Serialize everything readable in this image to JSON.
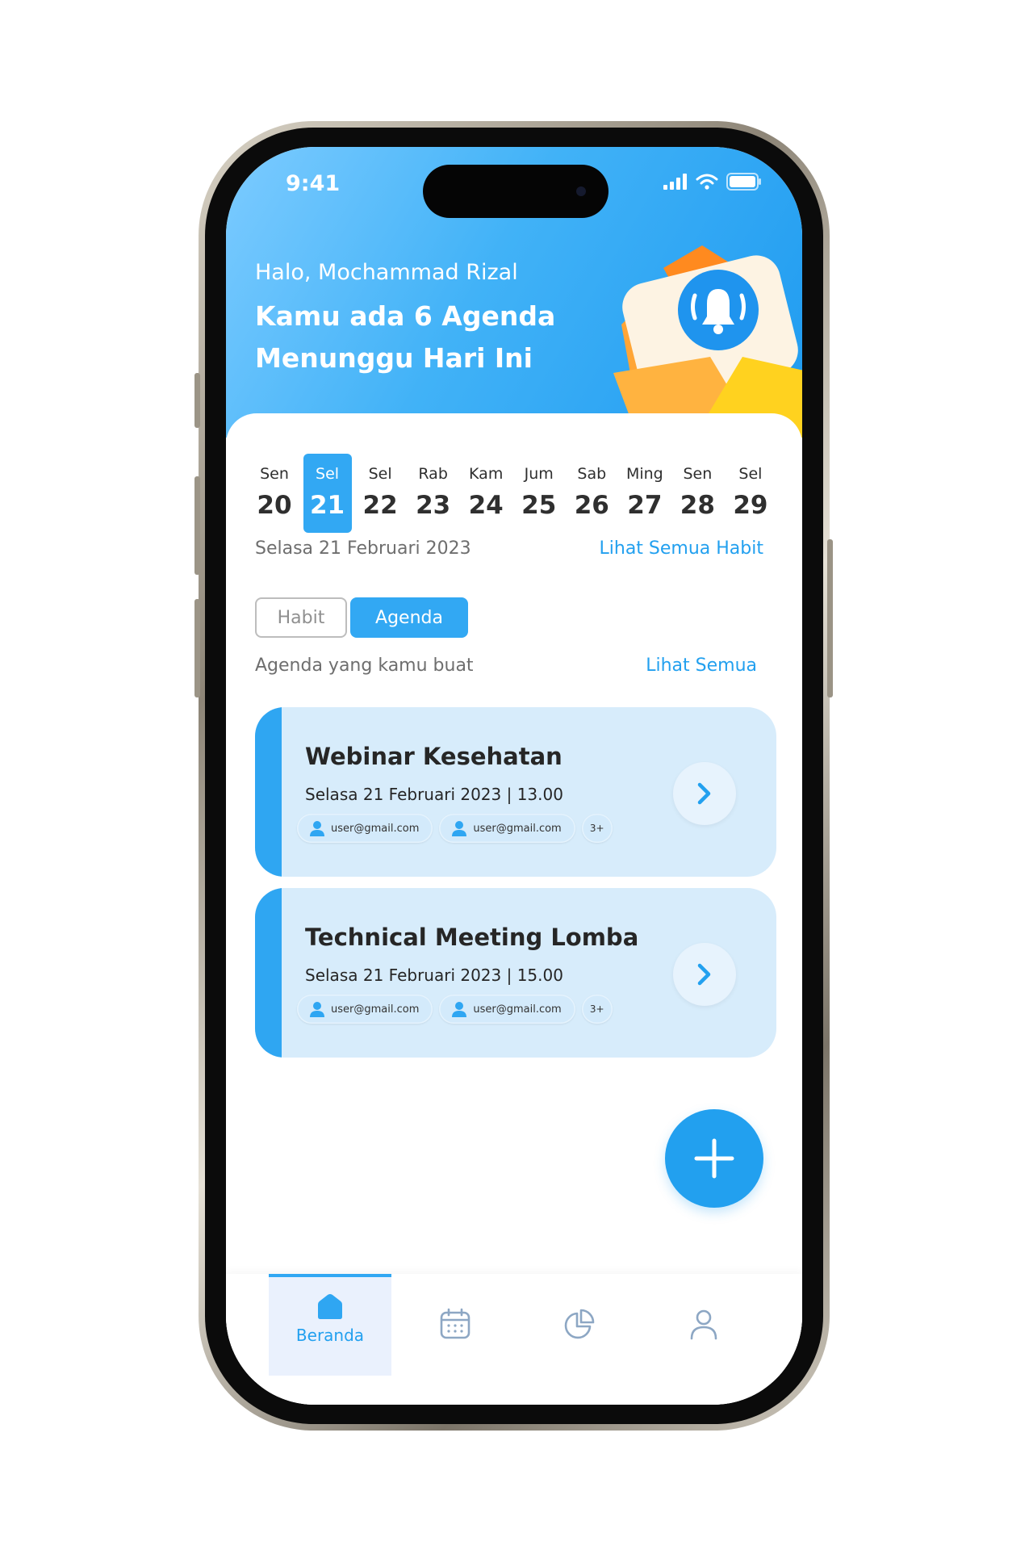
{
  "status_bar": {
    "time": "9:41"
  },
  "header": {
    "greeting": "Halo, Mochammad Rizal",
    "headline_line1": "Kamu ada 6 Agenda",
    "headline_line2": "Menunggu Hari Ini",
    "illustration_icon": "bell-icon"
  },
  "calendar": {
    "days": [
      {
        "name": "Sen",
        "date": "20"
      },
      {
        "name": "Sel",
        "date": "21",
        "selected": true
      },
      {
        "name": "Sel",
        "date": "22"
      },
      {
        "name": "Rab",
        "date": "23"
      },
      {
        "name": "Kam",
        "date": "24"
      },
      {
        "name": "Jum",
        "date": "25"
      },
      {
        "name": "Sab",
        "date": "26"
      },
      {
        "name": "Ming",
        "date": "27"
      },
      {
        "name": "Sen",
        "date": "28"
      },
      {
        "name": "Sel",
        "date": "29"
      }
    ],
    "selected_date_text": "Selasa 21 Februari 2023",
    "see_all_habit": "Lihat Semua Habit"
  },
  "toggle": {
    "habit": "Habit",
    "agenda": "Agenda",
    "active": "Agenda"
  },
  "agenda_section": {
    "title": "Agenda yang kamu buat",
    "see_all": "Lihat Semua"
  },
  "agendas": [
    {
      "title": "Webinar Kesehatan",
      "datetime": "Selasa 21 Februari 2023 | 13.00",
      "participants": [
        "user@gmail.com",
        "user@gmail.com"
      ],
      "more": "3+"
    },
    {
      "title": "Technical Meeting Lomba",
      "datetime": "Selasa 21 Februari 2023 | 15.00",
      "participants": [
        "user@gmail.com",
        "user@gmail.com"
      ],
      "more": "3+"
    }
  ],
  "fab": {
    "icon": "plus-icon"
  },
  "tabbar": {
    "items": [
      {
        "label": "Beranda",
        "icon": "home-icon",
        "active": true
      },
      {
        "label": "",
        "icon": "calendar-icon"
      },
      {
        "label": "",
        "icon": "pie-chart-icon"
      },
      {
        "label": "",
        "icon": "profile-icon"
      }
    ]
  },
  "colors": {
    "primary": "#32a8f3",
    "link": "#22a0ef",
    "card_bg": "#d7ecfb",
    "text": "#262626"
  }
}
